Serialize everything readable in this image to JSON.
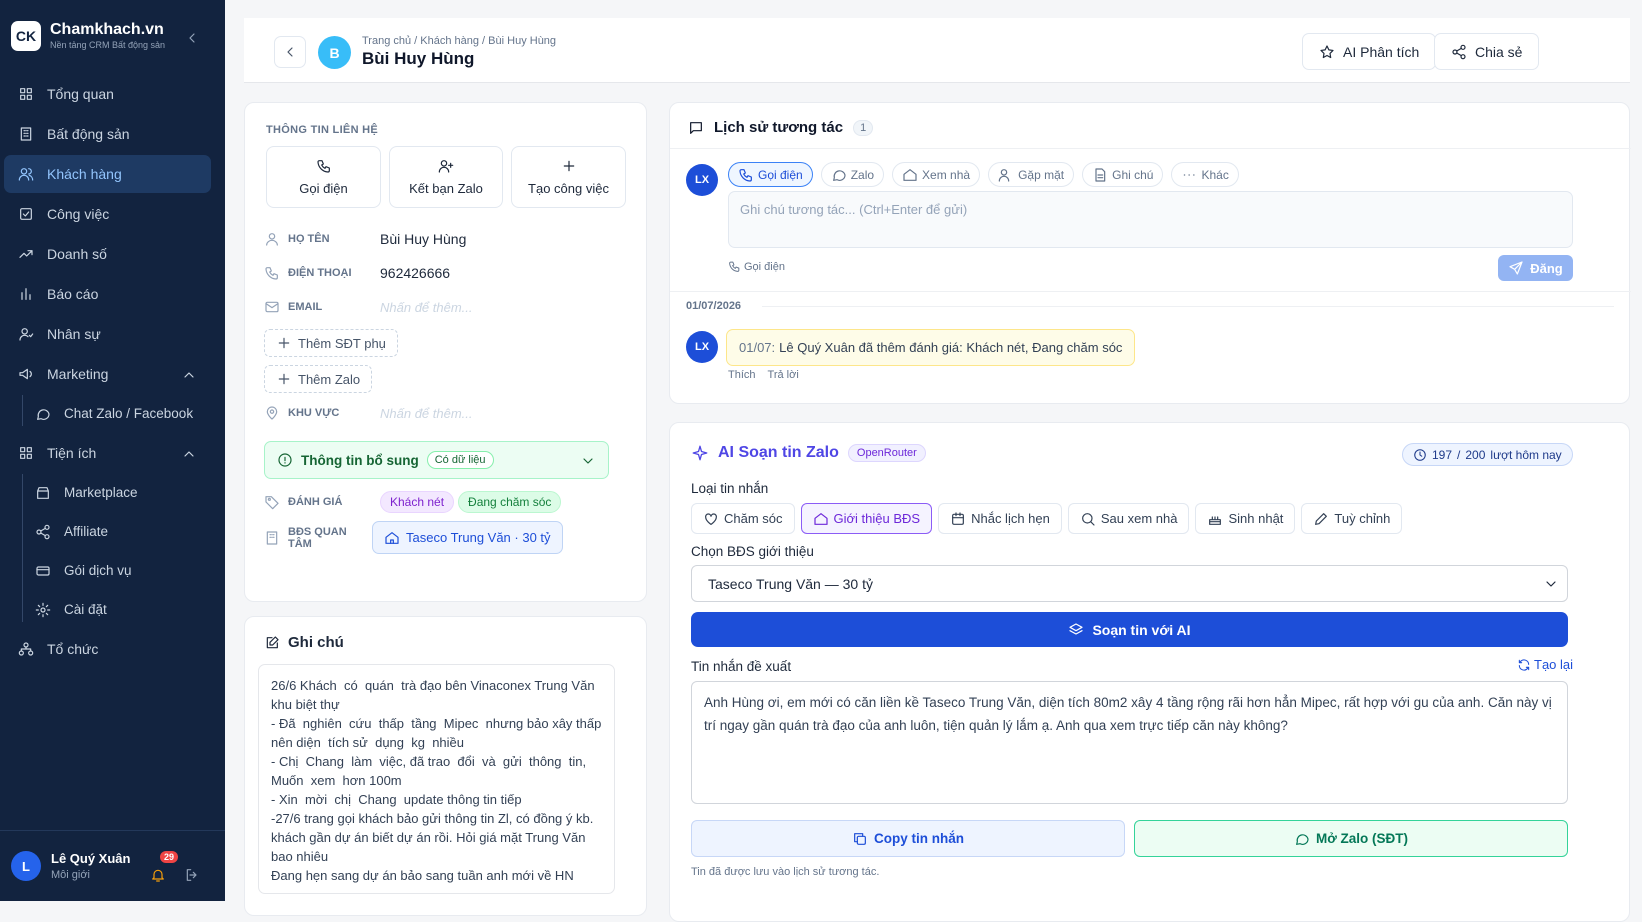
{
  "brand": {
    "name": "Chamkhach.vn",
    "tagline": "Nền tảng CRM Bất động sản",
    "logo": "CK"
  },
  "nav": {
    "overview": "Tổng quan",
    "realestate": "Bất động sản",
    "customers": "Khách hàng",
    "tasks": "Công việc",
    "revenue": "Doanh số",
    "reports": "Báo cáo",
    "staff": "Nhân sự",
    "marketing": "Marketing",
    "chat": "Chat Zalo / Facebook",
    "utilities": "Tiện ích",
    "marketplace": "Marketplace",
    "affiliate": "Affiliate",
    "plans": "Gói dịch vụ",
    "settings": "Cài đặt",
    "org": "Tổ chức"
  },
  "user": {
    "initial": "L",
    "name": "Lê Quý Xuân",
    "role": "Môi giới",
    "notifications": "29"
  },
  "header": {
    "initial": "B",
    "breadcrumb": "Trang chủ / Khách hàng / Bùi Huy Hùng",
    "title": "Bùi Huy Hùng",
    "ai_button": "AI Phân tích",
    "share_button": "Chia sẻ"
  },
  "contact": {
    "section": "THÔNG TIN LIÊN HỆ",
    "actions": {
      "call": "Gọi điện",
      "zalo": "Kết bạn Zalo",
      "task": "Tạo công việc"
    },
    "name_label": "HỌ TÊN",
    "name": "Bùi Huy Hùng",
    "phone_label": "ĐIỆN THOẠI",
    "phone": "962426666",
    "email_label": "EMAIL",
    "email_placeholder": "Nhấn để thêm...",
    "add_phone": "Thêm SĐT phụ",
    "add_zalo": "Thêm Zalo",
    "area_label": "KHU VỰC",
    "area_placeholder": "Nhấn để thêm...",
    "extra": "Thông tin bổ sung",
    "extra_badge": "Có dữ liệu",
    "rating_label": "ĐÁNH GIÁ",
    "rating_tags": [
      "Khách nét",
      "Đang chăm sóc"
    ],
    "property_label": "BĐS QUAN TÂM",
    "property": "Taseco Trung Văn · 30 tỷ"
  },
  "notes": {
    "title": "Ghi chú",
    "text": "26/6 Khách  có  quán  trà đạo bên Vinaconex Trung Văn khu biệt thự\n- Đã  nghiên  cứu  thấp  tầng  Mipec  nhưng bảo xây thấp nên diện  tích sử  dụng  kg  nhiều\n- Chị  Chang  làm  việc, đã trao  đổi  và  gửi  thông  tin, Muốn  xem  hơn 100m\n- Xin  mời  chị  Chang  update thông tin tiếp\n-27/6 trang gọi khách bảo gửi thông tin Zl, có đồng ý kb. khách gần dự án biết dự án rồi. Hỏi giá mặt Trung Văn bao nhiêu\nĐang hẹn sang dự án bảo sang tuần anh mới về HN"
  },
  "history": {
    "title": "Lịch sử tương tác",
    "count": "1",
    "avatar": "LX",
    "types": [
      "Gọi điện",
      "Zalo",
      "Xem nhà",
      "Gặp mặt",
      "Ghi chú",
      "Khác"
    ],
    "placeholder": "Ghi chú tương tác... (Ctrl+Enter để gửi)",
    "mode": "Gọi điện",
    "post": "Đăng",
    "date": "01/07/2026",
    "entry_date": "01/07:",
    "entry": "Lê Quý Xuân đã thêm đánh giá: Khách nét, Đang chăm sóc",
    "like": "Thích",
    "reply": "Trả lời"
  },
  "ai": {
    "title": "AI Soạn tin Zalo",
    "provider": "OpenRouter",
    "quota_used": "197",
    "quota_sep": "/",
    "quota_total": "200",
    "quota_label": "lượt hôm nay",
    "type_label": "Loại tin nhắn",
    "types": [
      "Chăm sóc",
      "Giới thiệu BĐS",
      "Nhắc lịch hẹn",
      "Sau xem nhà",
      "Sinh nhật",
      "Tuỳ chỉnh"
    ],
    "property_label": "Chọn BĐS giới thiệu",
    "property_selected": "Taseco Trung Văn — 30 tỷ",
    "generate": "Soạn tin với AI",
    "suggest_label": "Tin nhắn đề xuất",
    "regenerate": "Tạo lại",
    "message": "Anh Hùng ơi, em mới có căn liền kề Taseco Trung Văn, diện tích 80m2 xây 4 tầng rộng rãi hơn hẳn Mipec, rất hợp với gu của anh. Căn này vị trí ngay gần quán trà đạo của anh luôn, tiện quản lý lắm ạ. Anh qua xem trực tiếp căn này không?",
    "copy": "Copy tin nhắn",
    "open_zalo": "Mở Zalo (SĐT)",
    "saved": "Tin đã được lưu vào lịch sử tương tác."
  },
  "colors": {
    "sidebar": "#12233f",
    "primary": "#1d4ed8",
    "ai": "#4f46e5"
  }
}
